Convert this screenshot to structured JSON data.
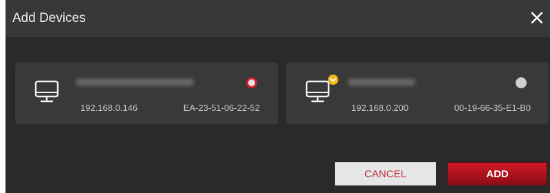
{
  "dialog": {
    "title": "Add Devices",
    "close_icon": "close-icon"
  },
  "devices": [
    {
      "name": "",
      "name_blurred": true,
      "ip": "192.168.0.146",
      "mac": "EA-23-51-06-22-52",
      "icon": "monitor-icon",
      "selected": true
    },
    {
      "name": "",
      "name_blurred": true,
      "ip": "192.168.0.200",
      "mac": "00-19-66-35-E1-B0",
      "icon": "monitor-icon",
      "badge_icon": "chevron-down-badge-icon",
      "selected": false
    }
  ],
  "buttons": {
    "cancel_label": "CANCEL",
    "add_label": "ADD"
  },
  "colors": {
    "accent_red": "#d21e2d",
    "badge_yellow": "#f2b91c"
  }
}
